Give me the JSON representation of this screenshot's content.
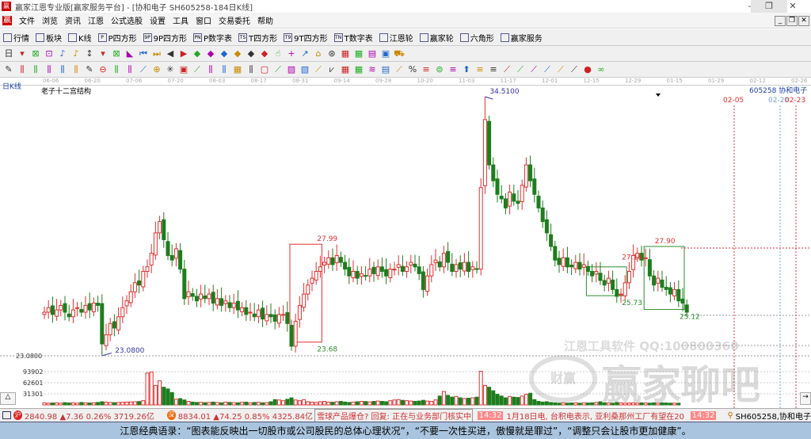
{
  "window": {
    "title": "赢家江恩专业版[赢家服务平台] - [协和电子  SH605258-184日K线]",
    "minimize": "–",
    "maximize": "❐",
    "close": "✕"
  },
  "menu": [
    "文件",
    "浏览",
    "资讯",
    "江恩",
    "公式选股",
    "设置",
    "工具",
    "窗口",
    "交易委托",
    "帮助"
  ],
  "mdi_controls": [
    "_",
    "❐",
    "✕"
  ],
  "toolbar1": [
    {
      "icon": "quote-icon",
      "label": "行情"
    },
    {
      "icon": "sector-icon",
      "label": "板块"
    },
    {
      "icon": "kline-icon",
      "label": "K线"
    },
    {
      "icon": "P",
      "label": "P四方形"
    },
    {
      "icon": "9P",
      "label": "9P四方形"
    },
    {
      "icon": "PN",
      "label": "P数字表"
    },
    {
      "icon": "TS",
      "label": "T四方形"
    },
    {
      "icon": "T9",
      "label": "9T四方形"
    },
    {
      "icon": "TN",
      "label": "T数字表"
    },
    {
      "icon": "gann-wheel-icon",
      "label": "江恩轮"
    },
    {
      "icon": "winner-wheel-icon",
      "label": "赢家轮"
    },
    {
      "icon": "hexagon-icon",
      "label": "六角形"
    },
    {
      "icon": "dollar-icon",
      "label": "赢家服务"
    }
  ],
  "toolbar2": [
    "日",
    "▾",
    "⊠",
    "⊡",
    "♪",
    "♪",
    "↕",
    "▾",
    "⊠",
    "◣",
    "⏮",
    "⏭",
    "◀",
    "▶",
    "◆",
    "◆",
    "◆",
    "◆",
    "◆",
    "◆",
    "☝",
    "+",
    "↗",
    "⌂",
    "⊛",
    "▦",
    "▦",
    "▤",
    "▣",
    "⛟"
  ],
  "toolbar3": [
    "✎",
    "⫼",
    "⫼",
    "⫼",
    "⫼",
    "⫼",
    "✎",
    "⊖",
    "⫼",
    "⫼",
    "⟋",
    "⊕",
    "✳",
    "▣",
    "⟋",
    "⫼",
    "⫼",
    "▦",
    "⫼",
    "▢",
    "⟋",
    "▧",
    "▧",
    "⟋",
    "⩗",
    "▦",
    "▦",
    "≋",
    "▤",
    "⟋",
    "%",
    "≡",
    "⊜",
    "≡",
    "⬆",
    "≡",
    "≡",
    "⟋",
    "⟋",
    "⟋",
    "⟋",
    "⟋",
    "⟋",
    "●",
    "∞"
  ],
  "chart": {
    "period_label": "日K线",
    "indicator_label": "老子十二宫结构",
    "stock_label": "605258 协和电子",
    "dates": [
      "06-06",
      "06-20",
      "07-06",
      "07-20",
      "08-03",
      "08-17",
      "08-31",
      "09-14",
      "09-28",
      "10-20",
      "11-03",
      "11-17",
      "12-01",
      "12-15",
      "12-29",
      "01-15",
      "01-29",
      "02-12",
      "02-26"
    ],
    "future_dates": [
      {
        "label": "02-05",
        "color": "#e03030"
      },
      {
        "label": "02-20",
        "color": "#6fa0d8"
      },
      {
        "label": "02-23",
        "color": "#e03030"
      }
    ],
    "price_axis_label": "23.0800",
    "volume_axis_labels": [
      "93902",
      "62601",
      "31301"
    ],
    "annotations": [
      {
        "text": "34.5100",
        "color": "#3333aa",
        "i": 107,
        "p": 34.51
      },
      {
        "text": "23.0800",
        "color": "#3333aa",
        "i": 16,
        "p": 23.08
      },
      {
        "text": "27.99",
        "color": "#e03030",
        "i": 67,
        "p": 28.0
      },
      {
        "text": "23.68",
        "color": "#2e8b2e",
        "i": 67,
        "p": 23.68
      },
      {
        "text": "27.90",
        "color": "#e03030",
        "i": 149,
        "p": 27.9
      },
      {
        "text": "27.18",
        "color": "#e03030",
        "i": 141,
        "p": 27.18
      },
      {
        "text": "25.73",
        "color": "#2e8b2e",
        "i": 141,
        "p": 25.73
      },
      {
        "text": "25.12",
        "color": "#2e8b2e",
        "i": 155,
        "p": 25.12
      }
    ],
    "watermark1": "江恩工具软件  QQ:100800360",
    "watermark2": "赢家聊吧",
    "watermark_logo": "财赢"
  },
  "chart_data": {
    "type": "candlestick",
    "high": 34.51,
    "low": 23.08,
    "close": [
      25.0,
      25.2,
      24.9,
      25.1,
      25.3,
      25.0,
      24.8,
      25.1,
      25.2,
      25.0,
      25.3,
      25.1,
      25.4,
      25.3,
      23.6,
      24.0,
      24.5,
      24.3,
      24.8,
      25.2,
      25.5,
      25.9,
      26.3,
      26.2,
      26.8,
      27.0,
      27.6,
      28.5,
      29.0,
      28.2,
      27.5,
      27.3,
      27.8,
      26.9,
      25.6,
      25.9,
      25.7,
      25.5,
      25.8,
      25.6,
      25.8,
      25.4,
      25.6,
      25.3,
      25.5,
      25.2,
      25.4,
      25.1,
      25.2,
      24.9,
      25.0,
      24.8,
      25.1,
      24.7,
      24.9,
      24.8,
      24.6,
      24.9,
      24.9,
      24.5,
      23.5,
      24.6,
      25.3,
      25.8,
      26.2,
      26.5,
      26.8,
      27.0,
      27.2,
      27.4,
      27.1,
      27.5,
      27.2,
      26.9,
      26.6,
      26.8,
      26.5,
      26.7,
      26.6,
      26.9,
      26.7,
      27.0,
      26.8,
      26.6,
      26.9,
      26.9,
      27.1,
      26.8,
      27.0,
      27.2,
      27.0,
      26.7,
      26.0,
      26.6,
      27.1,
      27.3,
      27.0,
      27.6,
      27.2,
      26.8,
      27.1,
      26.9,
      27.2,
      26.8,
      27.0,
      26.9,
      30.5,
      33.5,
      31.5,
      30.8,
      30.2,
      30.0,
      29.6,
      30.3,
      29.9,
      29.8,
      30.6,
      31.5,
      30.8,
      30.2,
      29.6,
      29.0,
      28.5,
      27.9,
      27.3,
      27.1,
      27.4,
      27.0,
      27.0,
      27.2,
      26.9,
      27.1,
      26.8,
      26.6,
      26.8,
      26.4,
      26.2,
      26.5,
      26.0,
      25.7,
      25.8,
      26.3,
      26.8,
      27.5,
      27.6,
      27.3,
      27.4,
      26.6,
      26.2,
      26.5,
      26.1,
      26.0,
      25.8,
      26.0,
      25.5,
      25.4,
      25.0
    ],
    "volume": [
      6000,
      5000,
      5500,
      6000,
      5000,
      6500,
      5500,
      6000,
      5000,
      7000,
      6000,
      5500,
      6000,
      7000,
      9000,
      8000,
      7000,
      6500,
      7000,
      7500,
      8000,
      8500,
      9000,
      9500,
      12000,
      90000,
      93000,
      55000,
      68000,
      50000,
      45000,
      35000,
      16000,
      18000,
      14000,
      10000,
      8000,
      7000,
      7500,
      6500,
      7000,
      8000,
      7000,
      6000,
      8000,
      7000,
      6500,
      6000,
      7500,
      8000,
      6000,
      7000,
      7500,
      6000,
      6500,
      9000,
      15000,
      14000,
      12000,
      16000,
      20000,
      14000,
      12000,
      15000,
      9000,
      8000,
      7000,
      9000,
      10000,
      8000,
      7500,
      9000,
      10000,
      8000,
      7000,
      8000,
      9000,
      10000,
      9500,
      8500,
      10000,
      11000,
      10000,
      9000,
      12000,
      14000,
      15000,
      13000,
      12000,
      11000,
      10000,
      11000,
      13000,
      11000,
      10000,
      14000,
      25000,
      38000,
      27000,
      22000,
      24000,
      20000,
      18000,
      19000,
      20000,
      22000,
      95000,
      55000,
      50000,
      40000,
      30000,
      25000,
      20000,
      24000,
      22000,
      21000,
      25000,
      30000,
      33000,
      15000,
      10000,
      8000,
      9000,
      7000,
      6000,
      5000,
      6000,
      5000,
      5500,
      6000,
      5000,
      6000,
      5500,
      6000,
      7000,
      9000,
      6000,
      5500,
      5000,
      7000,
      6000,
      5000,
      5500,
      6000,
      5000,
      6000,
      5500,
      5000,
      6000,
      5000,
      6000,
      5500,
      5000,
      5000,
      5000
    ]
  },
  "status": {
    "sh_badge": "沪",
    "sh": "2840.98 ▲7.36 0.26% 3719.26亿",
    "sz_badge": "深",
    "sz": "8834.01 ▲74.25 0.85% 4325.84亿",
    "news1": "雪球产品爆仓? 回复: 正在与业务部门核实中",
    "time1": "14:32",
    "news2": "1月18日电, 台积电表示, 亚利桑那州工厂有望在20",
    "time2": "14:32",
    "stock": "SH605258,协和电子"
  },
  "quote": "江恩经典语录：“图表能反映出一切股市或公司股民的总体心理状况”，“不要一次性买进，傲慢就是罪过”，“调整只会让股市更加健康”。",
  "colors": {
    "up": "#e03030",
    "down": "#1e7d1e",
    "box": "#2e8b2e"
  }
}
